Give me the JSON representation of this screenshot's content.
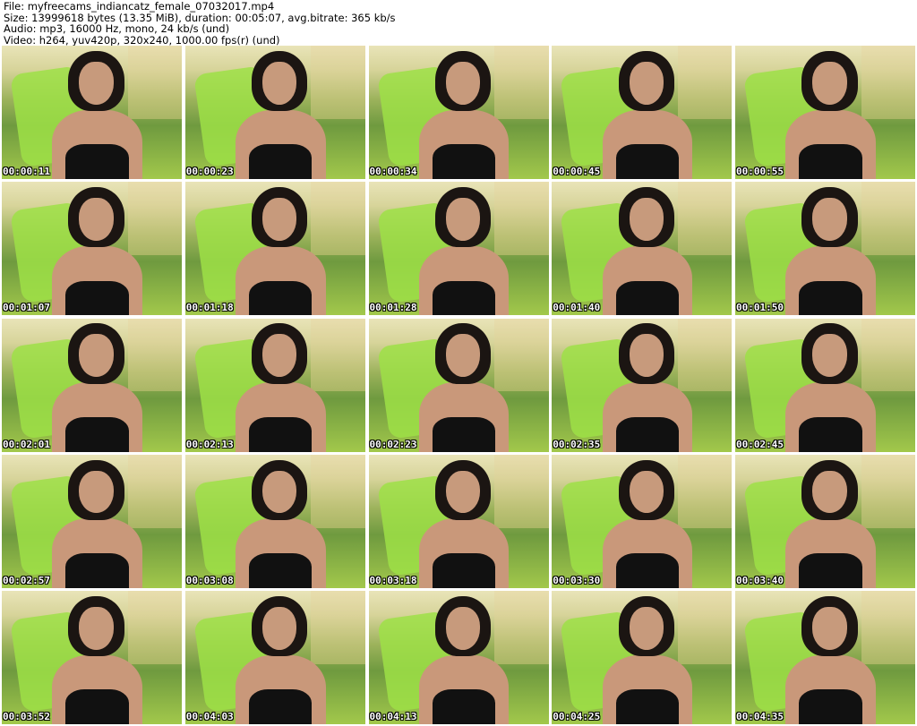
{
  "header": {
    "file": "File: myfreecams_indiancatz_female_07032017.mp4",
    "size": "Size: 13999618 bytes (13.35 MiB), duration: 00:05:07, avg.bitrate: 365 kb/s",
    "audio": "Audio: mp3, 16000 Hz, mono, 24 kb/s (und)",
    "video": "Video: h264, yuv420p, 320x240, 1000.00 fps(r) (und)"
  },
  "thumbnails": [
    "00:00:11",
    "00:00:23",
    "00:00:34",
    "00:00:45",
    "00:00:55",
    "00:01:07",
    "00:01:18",
    "00:01:28",
    "00:01:40",
    "00:01:50",
    "00:02:01",
    "00:02:13",
    "00:02:23",
    "00:02:35",
    "00:02:45",
    "00:02:57",
    "00:03:08",
    "00:03:18",
    "00:03:30",
    "00:03:40",
    "00:03:52",
    "00:04:03",
    "00:04:13",
    "00:04:25",
    "00:04:35"
  ]
}
